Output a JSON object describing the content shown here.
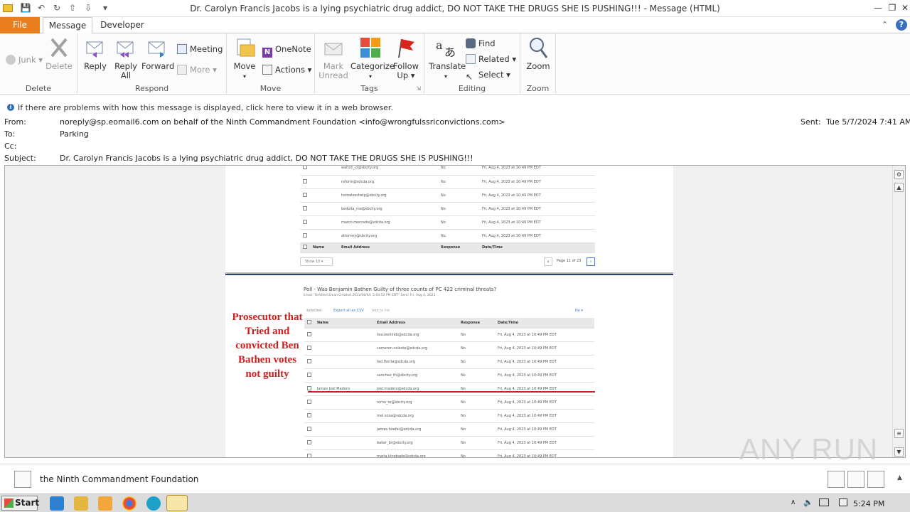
{
  "window": {
    "title": "Dr. Carolyn Francis Jacobs is a lying psychiatric drug addict, DO NOT TAKE THE DRUGS SHE IS PUSHING!!! - Message (HTML)"
  },
  "tabs": {
    "file": "File",
    "message": "Message",
    "developer": "Developer"
  },
  "ribbon": {
    "delete_group": {
      "label": "Delete",
      "junk": "Junk",
      "delete": "Delete"
    },
    "respond_group": {
      "label": "Respond",
      "reply": "Reply",
      "reply_all_1": "Reply",
      "reply_all_2": "All",
      "forward": "Forward",
      "meeting": "Meeting",
      "more": "More"
    },
    "move_group": {
      "label": "Move",
      "move": "Move",
      "onenote": "OneNote",
      "actions": "Actions"
    },
    "tags_group": {
      "label": "Tags",
      "mark_unread_1": "Mark",
      "mark_unread_2": "Unread",
      "categorize": "Categorize",
      "follow_up_1": "Follow",
      "follow_up_2": "Up"
    },
    "editing_group": {
      "label": "Editing",
      "translate": "Translate",
      "find": "Find",
      "related": "Related",
      "select": "Select"
    },
    "zoom_group": {
      "label": "Zoom",
      "zoom": "Zoom"
    }
  },
  "infobar": "If there are problems with how this message is displayed, click here to view it in a web browser.",
  "header": {
    "from_label": "From:",
    "from": "noreply@sp.eomail6.com on behalf of the Ninth Commandment Foundation <info@wrongfulssriconvictions.com>",
    "to_label": "To:",
    "to": "Parking",
    "cc_label": "Cc:",
    "subject_label": "Subject:",
    "subject": "Dr. Carolyn Francis Jacobs is a lying psychiatric drug addict, DO NOT TAKE THE DRUGS SHE IS PUSHING!!!",
    "sent_label": "Sent:",
    "sent": "Tue 5/7/2024 7:41 AM"
  },
  "top_table": {
    "rows": [
      {
        "email": "walton_cl@sbcity.org",
        "response": "No",
        "date": "Fri, Aug 4, 2023 at 10:49 PM EDT"
      },
      {
        "email": "reform@sdcda.org",
        "response": "No",
        "date": "Fri, Aug 4, 2023 at 10:49 PM EDT"
      },
      {
        "email": "homelesshelp@sbcity.org",
        "response": "No",
        "date": "Fri, Aug 4, 2023 at 10:49 PM EDT"
      },
      {
        "email": "bedolla_ma@sbcity.org",
        "response": "No",
        "date": "Fri, Aug 4, 2023 at 10:49 PM EDT"
      },
      {
        "email": "marco.mercado@sdcda.org",
        "response": "No",
        "date": "Fri, Aug 4, 2023 at 10:49 PM EDT"
      },
      {
        "email": "attorney@sbcity.org",
        "response": "No",
        "date": "Fri, Aug 4, 2023 at 10:49 PM EDT"
      }
    ],
    "headers": {
      "name": "Name",
      "email": "Email Address",
      "response": "Response",
      "date": "Date/Time"
    },
    "show": "Show 10",
    "page": "Page 11 of 23"
  },
  "poll": {
    "title": "Poll - Was Benjamin Bathen Guilty of three counts of PC 422 criminal threats?",
    "subtitle": "Email \"Untitled Email Created 2023/08/04, 5:04:52 PM EDT\" Sent: Fri, Aug 4, 2023",
    "selected": "selected",
    "export": "Export all as CSV",
    "add_to_list": "Add to list",
    "filter": "No",
    "headers": {
      "name": "Name",
      "email": "Email Address",
      "response": "Response",
      "date": "Date/Time"
    },
    "rows": [
      {
        "name": "",
        "email": "lisa.weinreb@sdcda.org",
        "response": "No",
        "date": "Fri, Aug 4, 2023 at 10:49 PM EDT"
      },
      {
        "name": "",
        "email": "cameron.celeste@sdcda.org",
        "response": "No",
        "date": "Fri, Aug 4, 2023 at 10:49 PM EDT"
      },
      {
        "name": "",
        "email": "ted.florita@sdcda.org",
        "response": "No",
        "date": "Fri, Aug 4, 2023 at 10:49 PM EDT"
      },
      {
        "name": "",
        "email": "sanchez_th@sbcity.org",
        "response": "No",
        "date": "Fri, Aug 4, 2023 at 10:49 PM EDT"
      },
      {
        "name": "James Joel Madero",
        "email": "joel.madero@sdcda.org",
        "response": "No",
        "date": "Fri, Aug 4, 2023 at 10:49 PM EDT"
      },
      {
        "name": "",
        "email": "romo_te@sbcity.org",
        "response": "No",
        "date": "Fri, Aug 4, 2023 at 10:49 PM EDT"
      },
      {
        "name": "",
        "email": "mel.sosa@sdcda.org",
        "response": "No",
        "date": "Fri, Aug 4, 2023 at 10:49 PM EDT"
      },
      {
        "name": "",
        "email": "james.hoefer@sdcda.org",
        "response": "No",
        "date": "Fri, Aug 4, 2023 at 10:49 PM EDT"
      },
      {
        "name": "",
        "email": "baker_br@sbcity.org",
        "response": "No",
        "date": "Fri, Aug 4, 2023 at 10:49 PM EDT"
      },
      {
        "name": "",
        "email": "marla.kingbade@sdcda.org",
        "response": "No",
        "date": "Fri, Aug 4, 2023 at 10:49 PM EDT"
      }
    ]
  },
  "annotation": {
    "line1": "Prosecutor that",
    "line2": "Tried and",
    "line3": "convicted Ben",
    "line4": "Bathen votes",
    "line5": "not guilty"
  },
  "people_pane": {
    "name": "the Ninth Commandment Foundation"
  },
  "taskbar": {
    "start": "Start",
    "time": "5:24 PM"
  },
  "watermark": "ANY RUN",
  "colors": {
    "file_tab": "#e87e1e",
    "annotation": "#d01e1e",
    "info_icon": "#2f6db5"
  }
}
